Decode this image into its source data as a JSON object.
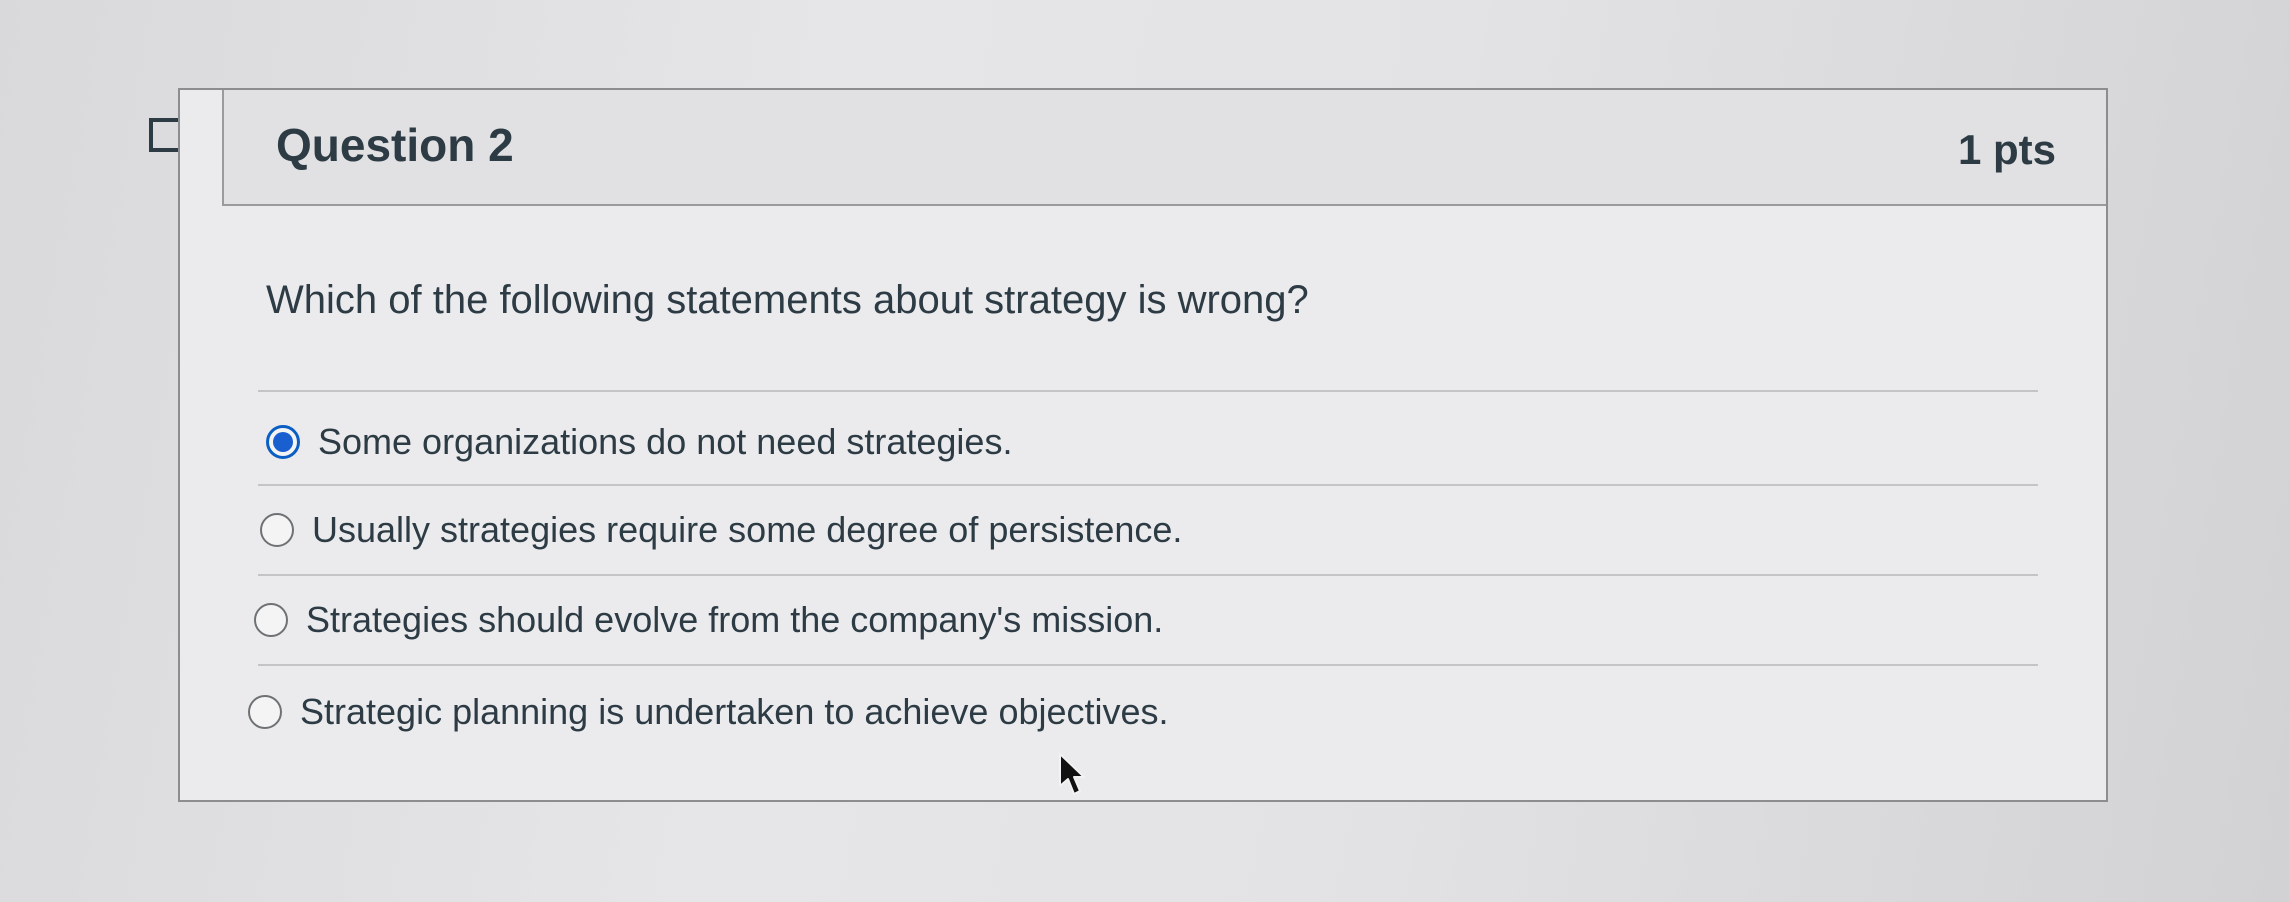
{
  "question": {
    "title": "Question 2",
    "points": "1 pts",
    "text": "Which of the following statements about strategy is wrong?"
  },
  "answers": [
    {
      "label": "Some organizations do not need strategies.",
      "selected": true
    },
    {
      "label": "Usually strategies require some degree of persistence.",
      "selected": false
    },
    {
      "label": "Strategies should evolve from the company's mission.",
      "selected": false
    },
    {
      "label": "Strategic planning is undertaken to achieve objectives.",
      "selected": false
    }
  ],
  "colors": {
    "text": "#2d3b45",
    "radio_selected": "#1a5fd0",
    "border": "#8d8d90"
  },
  "icons": {
    "flag": "flag-question-icon",
    "cursor": "mouse-pointer-icon"
  }
}
